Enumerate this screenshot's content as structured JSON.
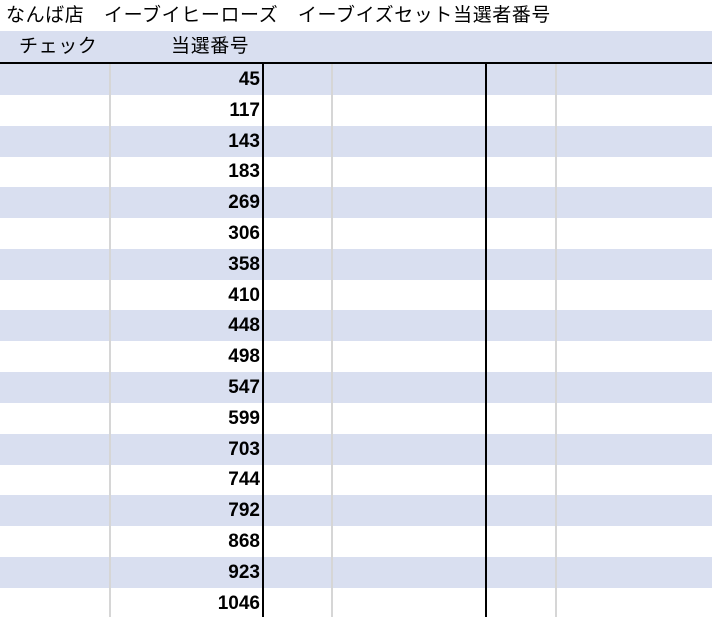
{
  "title": "なんば店　イーブイヒーローズ　イーブイズセット当選者番号",
  "header": {
    "check_label": "チェック",
    "number_label": "当選番号"
  },
  "rows": [
    {
      "number": "45"
    },
    {
      "number": "117"
    },
    {
      "number": "143"
    },
    {
      "number": "183"
    },
    {
      "number": "269"
    },
    {
      "number": "306"
    },
    {
      "number": "358"
    },
    {
      "number": "410"
    },
    {
      "number": "448"
    },
    {
      "number": "498"
    },
    {
      "number": "547"
    },
    {
      "number": "599"
    },
    {
      "number": "703"
    },
    {
      "number": "744"
    },
    {
      "number": "792"
    },
    {
      "number": "868"
    },
    {
      "number": "923"
    },
    {
      "number": "1046"
    }
  ],
  "colors": {
    "band": "#d9dff0",
    "grid_light": "#d6d6d6",
    "grid_dark": "#000000"
  }
}
